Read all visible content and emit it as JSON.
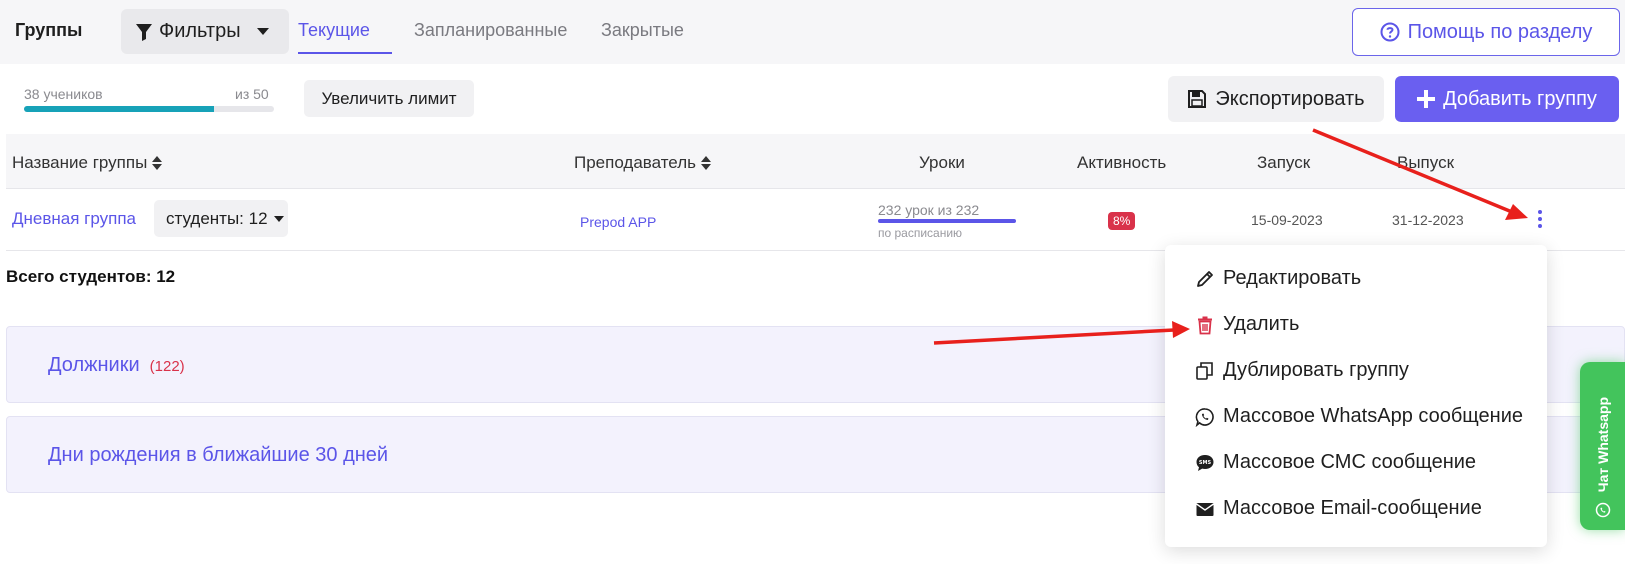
{
  "header": {
    "title": "Группы",
    "filters_label": "Фильтры",
    "tabs": [
      {
        "label": "Текущие",
        "active": true
      },
      {
        "label": "Запланированные",
        "active": false
      },
      {
        "label": "Закрытые",
        "active": false
      }
    ],
    "help_label": "Помощь по разделу"
  },
  "limit": {
    "students_label": "38 учеников",
    "of_label": "из 50",
    "progress_fraction": 0.76,
    "increase_label": "Увеличить лимит"
  },
  "actions": {
    "export_label": "Экспортировать",
    "add_group_label": "Добавить группу"
  },
  "table": {
    "headers": [
      "Название группы",
      "Преподаватель",
      "Уроки",
      "Активность",
      "Запуск",
      "Выпуск"
    ],
    "rows": [
      {
        "group_name": "Дневная группа",
        "students_label": "студенты: 12",
        "teacher": "Prepod APP",
        "lessons_text": "232 урок из 232",
        "lessons_fraction": 1.0,
        "lessons_sub": "по расписанию",
        "activity": "8%",
        "start": "15-09-2023",
        "end": "31-12-2023"
      }
    ]
  },
  "summary": {
    "total_students": "Всего студентов: 12"
  },
  "panels": [
    {
      "title": "Должники",
      "count": "(122)"
    },
    {
      "title": "Дни рождения в ближайшие 30 дней",
      "count": ""
    }
  ],
  "dropdown": {
    "items": [
      {
        "label": "Редактировать",
        "icon": "pencil-icon"
      },
      {
        "label": "Удалить",
        "icon": "trash-icon"
      },
      {
        "label": "Дублировать группу",
        "icon": "copy-icon"
      },
      {
        "label": "Массовое WhatsApp сообщение",
        "icon": "whatsapp-icon"
      },
      {
        "label": "Массовое СМС сообщение",
        "icon": "sms-icon"
      },
      {
        "label": "Массовое Email-сообщение",
        "icon": "envelope-icon"
      }
    ]
  },
  "whatsapp_chat": {
    "label": "Чат Whatsapp"
  },
  "colors": {
    "accent": "#5b55e8",
    "danger": "#d9324a",
    "whatsapp": "#43c45c",
    "progress": "#17a2b8"
  }
}
